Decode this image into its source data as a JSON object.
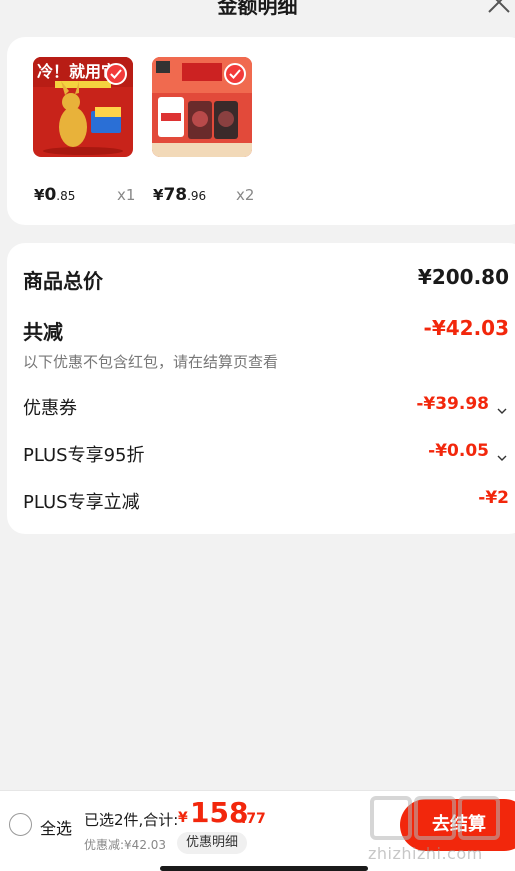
{
  "header": {
    "title": "金额明细",
    "close_icon": "close-icon"
  },
  "products": [
    {
      "thumb_text": "冷！就用它",
      "price_yen": "¥",
      "price_int": "0",
      "price_dec": ".85",
      "qty": "x1",
      "selected": true
    },
    {
      "price_yen": "¥",
      "price_int": "78",
      "price_dec": ".96",
      "qty": "x2",
      "selected": true
    }
  ],
  "summary": {
    "total_label": "商品总价",
    "total_value": "¥200.80",
    "reduce_label": "共减",
    "reduce_value": "-¥42.03",
    "hint": "以下优惠不包含红包，请在结算页查看",
    "items": [
      {
        "label": "优惠券",
        "value": "-¥39.98",
        "expandable": true
      },
      {
        "label": "PLUS专享95折",
        "value": "-¥0.05",
        "expandable": true
      },
      {
        "label": "PLUS专享立减",
        "value": "-¥2",
        "expandable": false
      }
    ]
  },
  "bottom": {
    "select_all": "全选",
    "selected_text": "已选2件,合计:",
    "sum_yen": "¥",
    "sum_int": "158",
    "sum_dec": ".77",
    "reduced_text": "优惠减:¥42.03",
    "detail_button": "优惠明细",
    "checkout_button": "去结算"
  },
  "watermark": {
    "site": "zhizhizhi.com"
  },
  "colors": {
    "accent_red": "#f2270c",
    "background": "#f2f2f2"
  }
}
